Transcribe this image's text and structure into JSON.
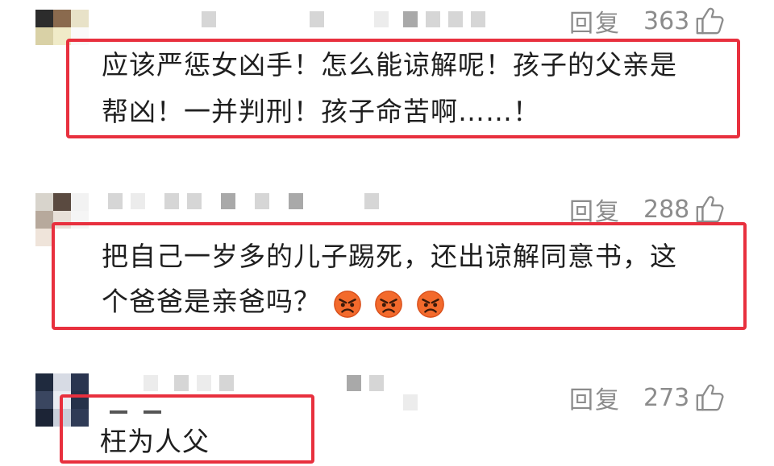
{
  "comments": [
    {
      "reply_label": "回复",
      "like_count": "363",
      "text_lines": [
        "应该严惩女凶手！怎么能谅解呢！孩子的父亲是",
        "帮凶！一并判刑！孩子命苦啊……！"
      ]
    },
    {
      "reply_label": "回复",
      "like_count": "288",
      "text_lines": [
        "把自己一岁多的儿子踢死，还出谅解同意书，这",
        "个爸爸是亲爸吗？"
      ],
      "emojis": [
        "angry-emoji",
        "angry-emoji",
        "angry-emoji"
      ]
    },
    {
      "reply_label": "回复",
      "like_count": "273",
      "text_lines": [
        "枉为人父"
      ]
    }
  ],
  "colors": {
    "highlight_box": "#e8303e",
    "meta_text": "#8c8c8c",
    "body_text": "#1f1f1f"
  },
  "icons": [
    "thumbs-up-icon",
    "angry-emoji"
  ]
}
